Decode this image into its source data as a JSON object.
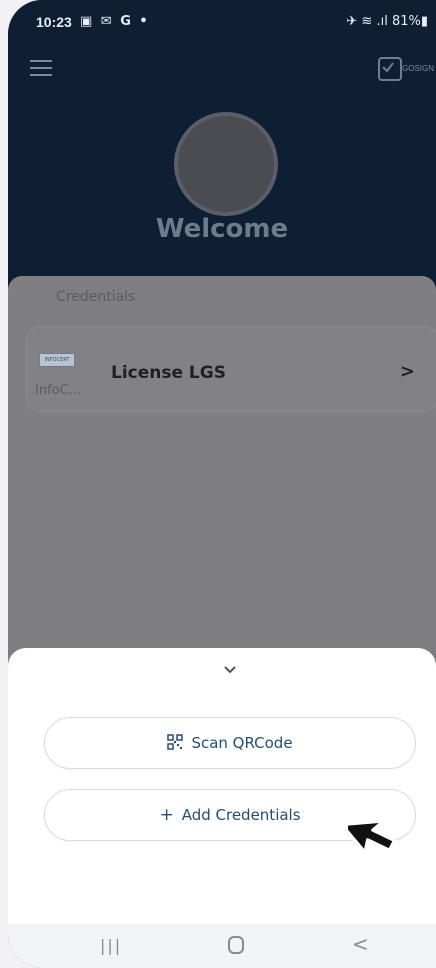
{
  "status_bar": {
    "time": "10:23",
    "left_icons": "▣ ✉ G •",
    "right_icons": "✈ ≋ .ıl 81%▮"
  },
  "header": {
    "logo_text": "GOSIGN",
    "welcome": "Welcome"
  },
  "credentials": {
    "section_label": "Credentials",
    "items": [
      {
        "logo_text": "INFOCERT",
        "issuer": "InfoC...",
        "title": "License LGS",
        "chevron": ">"
      }
    ]
  },
  "bottom_sheet": {
    "scan_label": "Scan QRCode",
    "add_plus": "+",
    "add_label": "Add Credentials"
  },
  "nav_bar": {
    "recent": "|||",
    "back": "<"
  },
  "colors": {
    "header_bg": "#0f1f33",
    "overlay": "#7f7f82",
    "button_text": "#1e4f7a"
  }
}
